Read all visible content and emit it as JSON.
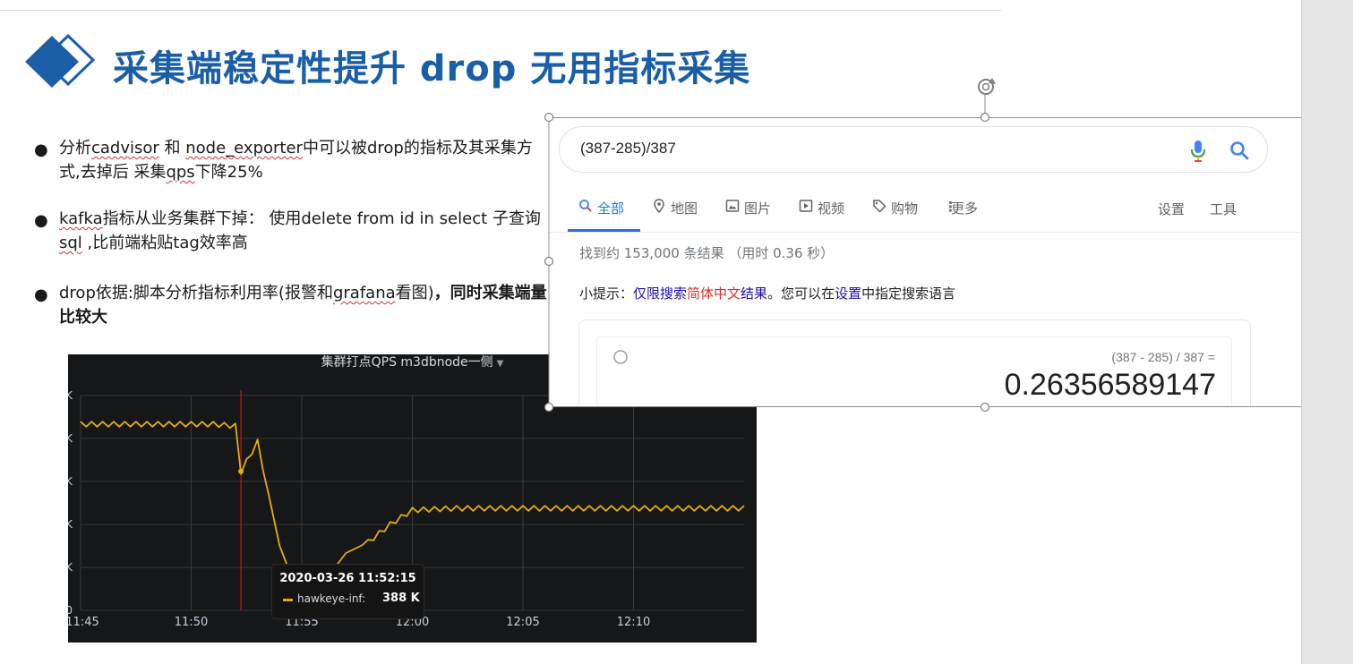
{
  "slide": {
    "title": "采集端稳定性提升 drop 无用指标采集"
  },
  "bullets": [
    {
      "parts": [
        {
          "t": "分析",
          "s": ""
        },
        {
          "t": "cadvisor",
          "s": "wavy"
        },
        {
          "t": " 和 ",
          "s": ""
        },
        {
          "t": "node_exporter",
          "s": "wavy"
        },
        {
          "t": "中可以被drop的指标及其采集方式,去掉后 采集",
          "s": ""
        },
        {
          "t": "qps",
          "s": "wavy"
        },
        {
          "t": "下降25%",
          "s": ""
        }
      ]
    },
    {
      "parts": [
        {
          "t": "kafka",
          "s": "wavy"
        },
        {
          "t": "指标从业务集群下掉： 使用delete from id in select 子查询",
          "s": ""
        },
        {
          "t": "sql",
          "s": "wavy"
        },
        {
          "t": " ,比前端粘贴tag效率高",
          "s": ""
        }
      ]
    },
    {
      "parts": [
        {
          "t": "drop依据:脚本分析指标利用率(报警和",
          "s": ""
        },
        {
          "t": "grafana",
          "s": "wavy"
        },
        {
          "t": "看图)",
          "s": ""
        },
        {
          "t": "，同时采集端量比较大",
          "s": "bold"
        }
      ]
    }
  ],
  "chart_data": {
    "type": "line",
    "title": "集群打点QPS m3dbnode一侧",
    "x_ticks": [
      "11:45",
      "11:50",
      "11:55",
      "12:00",
      "12:05",
      "12:10"
    ],
    "y_tick_labels": [
      "K",
      "K",
      "K",
      "K",
      "K",
      "0"
    ],
    "series": [
      {
        "name": "hawkeye-inf:",
        "color": "#e5ac0e",
        "values_note": "",
        "x": [
          "11:45",
          "11:47",
          "11:49",
          "11:51",
          "11:52",
          "11:52:15",
          "11:53",
          "11:54",
          "11:55",
          "11:56",
          "11:57",
          "11:58",
          "11:59",
          "12:00",
          "12:02",
          "12:05",
          "12:08",
          "12:10",
          "12:15"
        ],
        "y": [
          520,
          520,
          520,
          520,
          515,
          388,
          470,
          180,
          20,
          80,
          160,
          190,
          240,
          280,
          285,
          285,
          285,
          285,
          285
        ]
      }
    ],
    "tooltip": {
      "time": "2020-03-26 11:52:15",
      "series_name": "hawkeye-inf:",
      "value": "388 K"
    }
  },
  "search": {
    "query": "(387-285)/387",
    "tabs": [
      {
        "label": "全部",
        "icon": "search-icon",
        "active": true
      },
      {
        "label": "地图",
        "icon": "map-pin-icon",
        "active": false
      },
      {
        "label": "图片",
        "icon": "image-icon",
        "active": false
      },
      {
        "label": "视频",
        "icon": "video-icon",
        "active": false
      },
      {
        "label": "购物",
        "icon": "tag-icon",
        "active": false
      },
      {
        "label": "更多",
        "icon": "more-vert-icon",
        "active": false
      }
    ],
    "settings_label": "设置",
    "tools_label": "工具",
    "result_stats": "找到约 153,000 条结果 （用时 0.36 秒）",
    "tip": {
      "prefix": "小提示：",
      "link1": "仅限搜索",
      "link1_red": "简体中文",
      "link1_tail": "结果",
      "middle": "。您可以在",
      "link2": "设置",
      "suffix": "中指定搜索语言"
    },
    "calculator": {
      "expression": "(387 - 285) / 387 =",
      "result": "0.26356589147"
    }
  },
  "colors": {
    "title_blue": "#1a5ea8",
    "google_blue": "#1a73e8",
    "series_yellow": "#e5ac0e"
  }
}
